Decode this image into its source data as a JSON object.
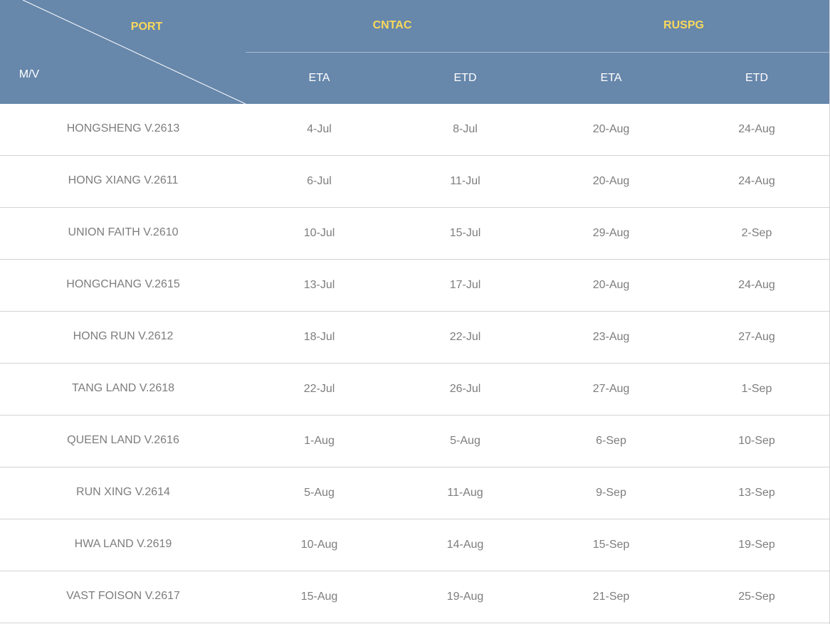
{
  "header": {
    "port_label": "PORT",
    "vessel_label": "M/V",
    "groups": [
      {
        "name": "CNTAC",
        "columns": [
          "ETA",
          "ETD"
        ]
      },
      {
        "name": "RUSPG",
        "columns": [
          "ETA",
          "ETD"
        ]
      }
    ]
  },
  "colors": {
    "header_bg": "#6787ab",
    "header_accent_text": "#f9d95b",
    "header_text": "#ffffff",
    "body_text": "#7d7d7d",
    "row_divider": "#d3d3d3"
  },
  "rows": [
    {
      "vessel": "HONGSHENG V.2613",
      "cntac_eta": "4-Jul",
      "cntac_etd": "8-Jul",
      "ruspg_eta": "20-Aug",
      "ruspg_etd": "24-Aug"
    },
    {
      "vessel": "HONG XIANG V.2611",
      "cntac_eta": "6-Jul",
      "cntac_etd": "11-Jul",
      "ruspg_eta": "20-Aug",
      "ruspg_etd": "24-Aug"
    },
    {
      "vessel": "UNION FAITH V.2610",
      "cntac_eta": "10-Jul",
      "cntac_etd": "15-Jul",
      "ruspg_eta": "29-Aug",
      "ruspg_etd": "2-Sep"
    },
    {
      "vessel": "HONGCHANG V.2615",
      "cntac_eta": "13-Jul",
      "cntac_etd": "17-Jul",
      "ruspg_eta": "20-Aug",
      "ruspg_etd": "24-Aug"
    },
    {
      "vessel": "HONG RUN V.2612",
      "cntac_eta": "18-Jul",
      "cntac_etd": "22-Jul",
      "ruspg_eta": "23-Aug",
      "ruspg_etd": "27-Aug"
    },
    {
      "vessel": "TANG LAND V.2618",
      "cntac_eta": "22-Jul",
      "cntac_etd": "26-Jul",
      "ruspg_eta": "27-Aug",
      "ruspg_etd": "1-Sep"
    },
    {
      "vessel": "QUEEN LAND V.2616",
      "cntac_eta": "1-Aug",
      "cntac_etd": "5-Aug",
      "ruspg_eta": "6-Sep",
      "ruspg_etd": "10-Sep"
    },
    {
      "vessel": "RUN XING V.2614",
      "cntac_eta": "5-Aug",
      "cntac_etd": "11-Aug",
      "ruspg_eta": "9-Sep",
      "ruspg_etd": "13-Sep"
    },
    {
      "vessel": "HWA LAND V.2619",
      "cntac_eta": "10-Aug",
      "cntac_etd": "14-Aug",
      "ruspg_eta": "15-Sep",
      "ruspg_etd": "19-Sep"
    },
    {
      "vessel": "VAST FOISON V.2617",
      "cntac_eta": "15-Aug",
      "cntac_etd": "19-Aug",
      "ruspg_eta": "21-Sep",
      "ruspg_etd": "25-Sep"
    }
  ]
}
